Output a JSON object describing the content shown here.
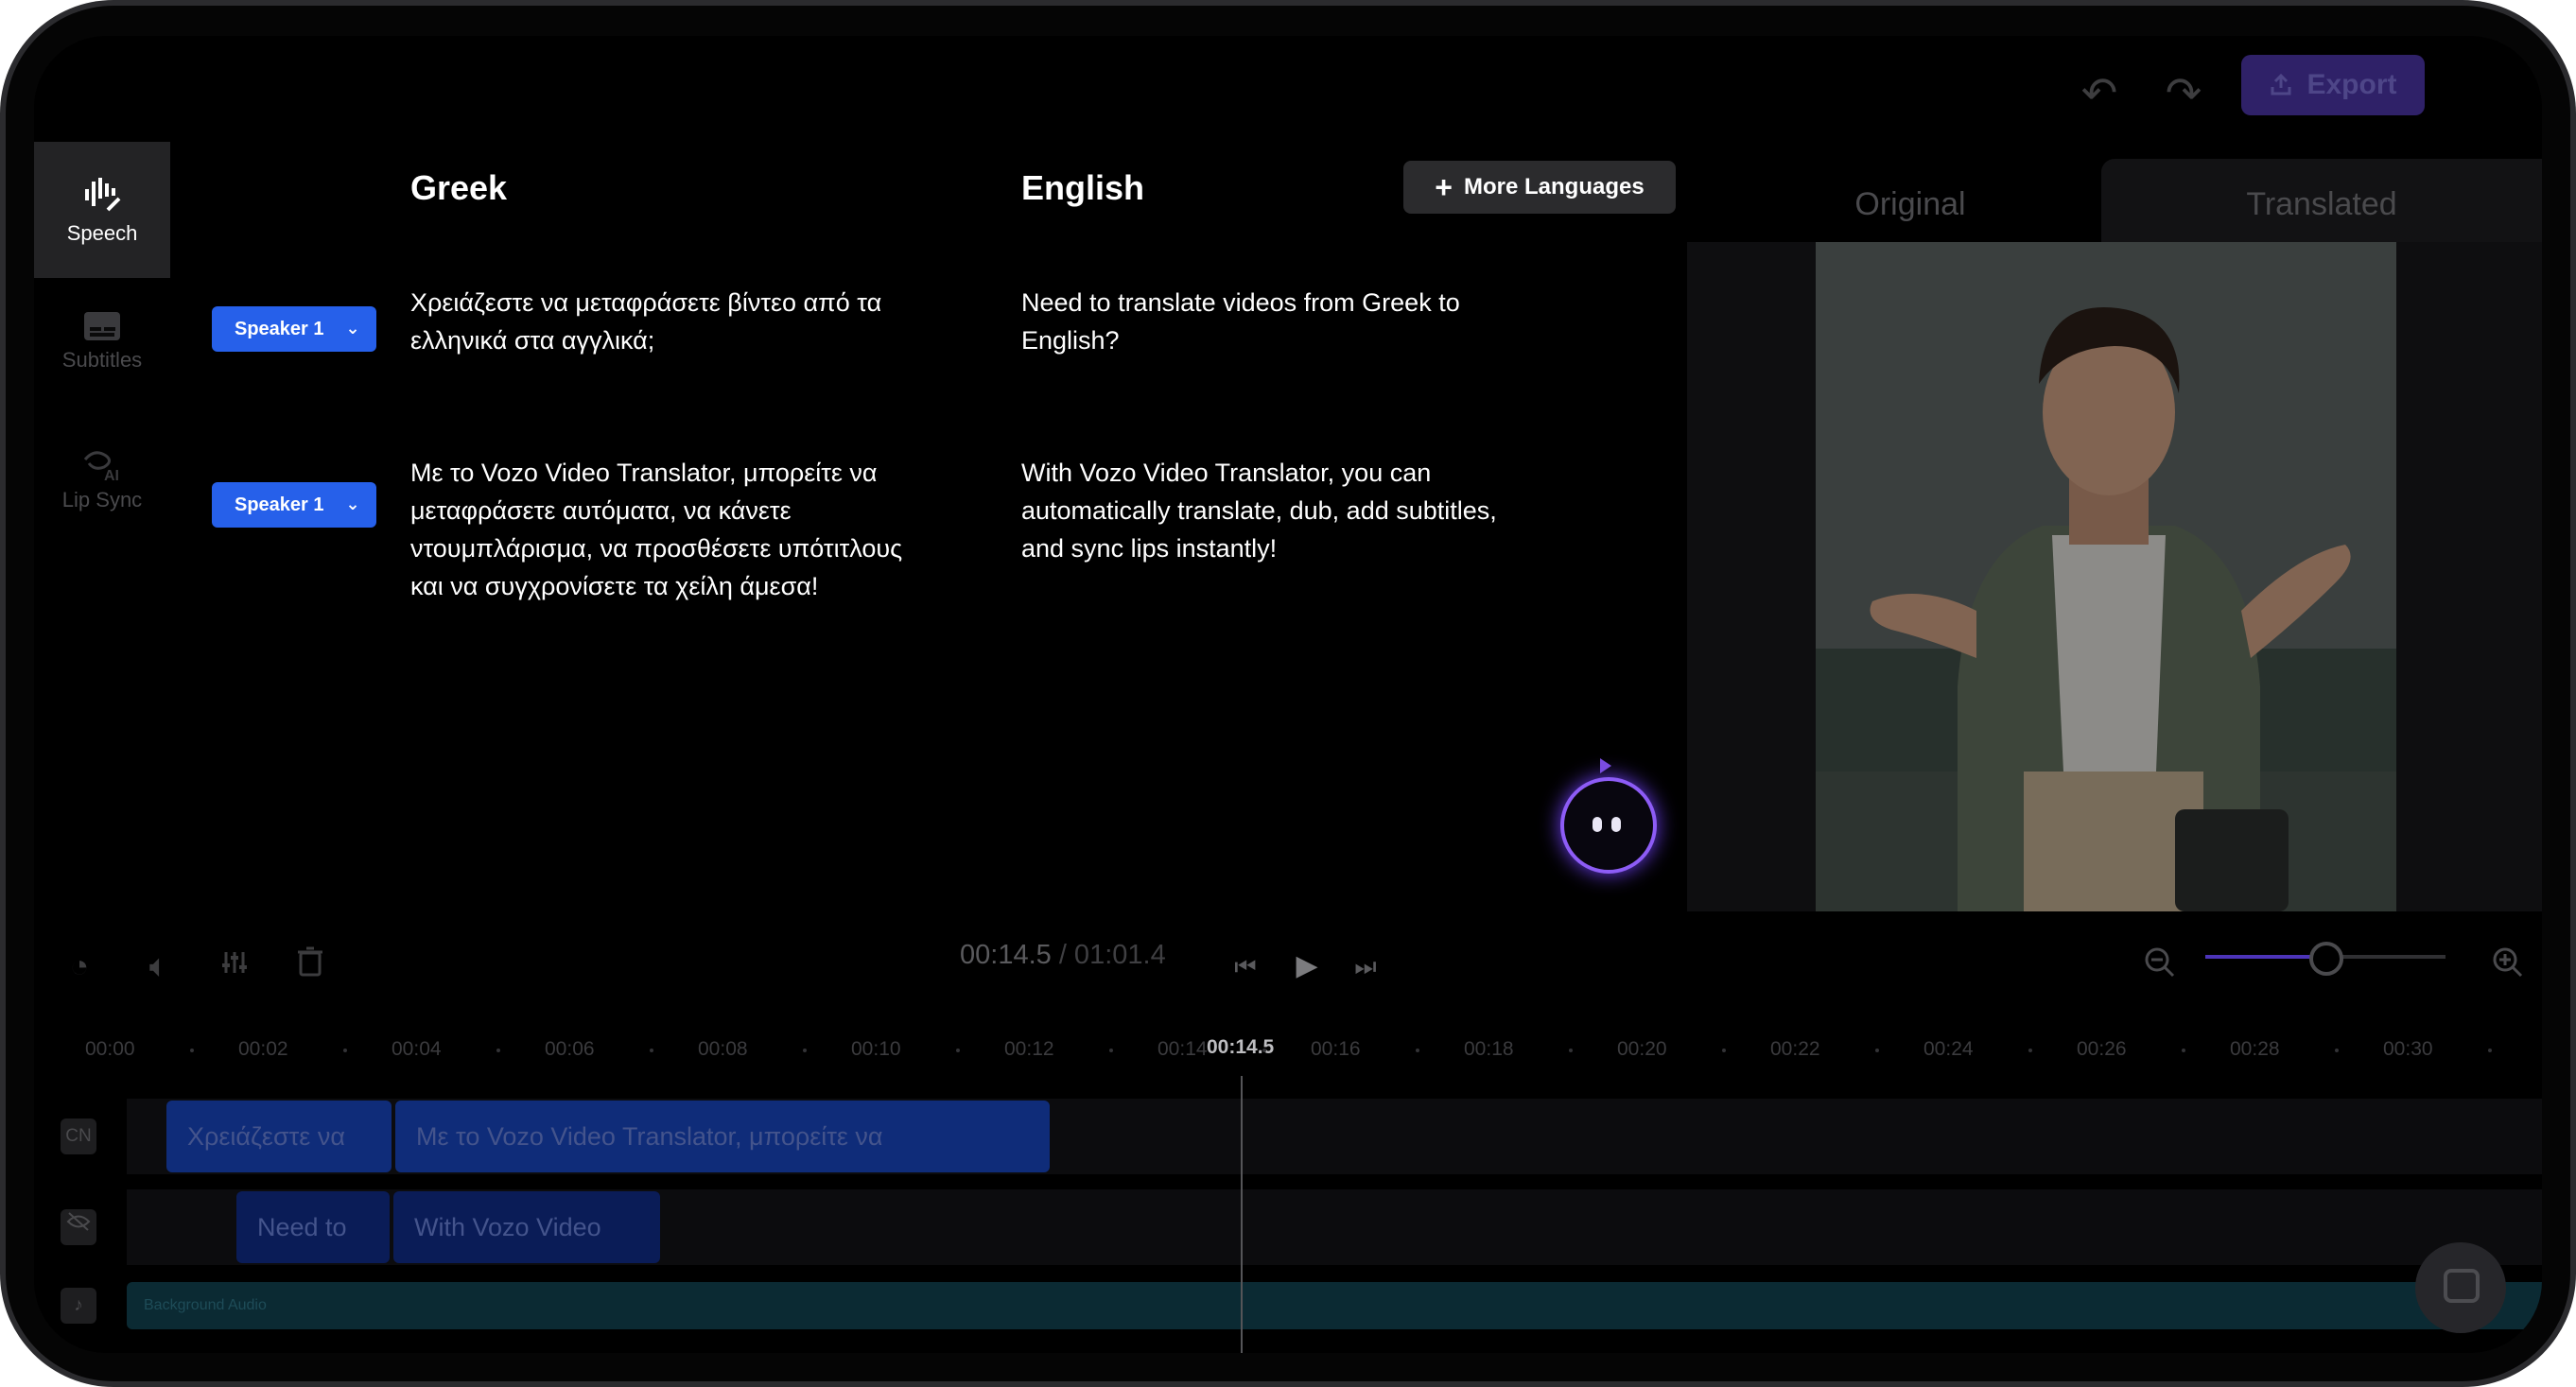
{
  "toolbar": {
    "undo_icon": "undo-icon",
    "redo_icon": "redo-icon",
    "export_label": "Export",
    "export_icon": "upload-icon",
    "export_color": "#2f2168"
  },
  "sidebar": {
    "items": [
      {
        "label": "Speech",
        "icon": "speech-wave-icon",
        "active": true
      },
      {
        "label": "Subtitles",
        "icon": "subtitles-icon",
        "active": false
      },
      {
        "label": "Lip Sync",
        "icon": "ai-lip-icon",
        "active": false
      }
    ]
  },
  "editor": {
    "source_language": "Greek",
    "target_language": "English",
    "more_languages_label": "More Languages",
    "segments": [
      {
        "speaker": "Speaker 1",
        "source_lines": [
          "Χρειάζεστε να μεταφράσετε βίντεο από τα",
          "ελληνικά στα αγγλικά;"
        ],
        "target_lines": [
          "Need to translate videos from Greek to",
          "English?"
        ]
      },
      {
        "speaker": "Speaker 1",
        "source_lines": [
          "Με το Vozo Video Translator, μπορείτε να",
          "μεταφράσετε αυτόματα, να κάνετε",
          "ντουμπλάρισμα, να προσθέσετε υπότιτλους",
          "και να συγχρονίσετε τα χείλη άμεσα!"
        ],
        "target_lines": [
          "With Vozo Video Translator, you can",
          "automatically translate, dub, add subtitles,",
          "and sync lips instantly!"
        ]
      }
    ]
  },
  "preview": {
    "tabs": [
      {
        "label": "Original",
        "active": false
      },
      {
        "label": "Translated",
        "active": true
      }
    ]
  },
  "playback": {
    "current_time": "00:14.5",
    "total_time": " / 01:01.4",
    "zoom_level": 0.5
  },
  "timeline": {
    "ticks": [
      "00:00",
      "00:02",
      "00:04",
      "00:06",
      "00:08",
      "00:10",
      "00:12",
      "00:14",
      "00:16",
      "00:18",
      "00:20",
      "00:22",
      "00:24",
      "00:26",
      "00:28",
      "00:30"
    ],
    "playhead_label": "00:14.5",
    "tracks": [
      {
        "badge": "CN",
        "clips": [
          "Χρειάζεστε να",
          "Με το Vozo Video Translator, μπορείτε να"
        ]
      },
      {
        "badge_icon": "eye-off-icon",
        "clips": [
          "Need to",
          "With Vozo Video"
        ]
      }
    ],
    "audio_label": "Background Audio"
  }
}
